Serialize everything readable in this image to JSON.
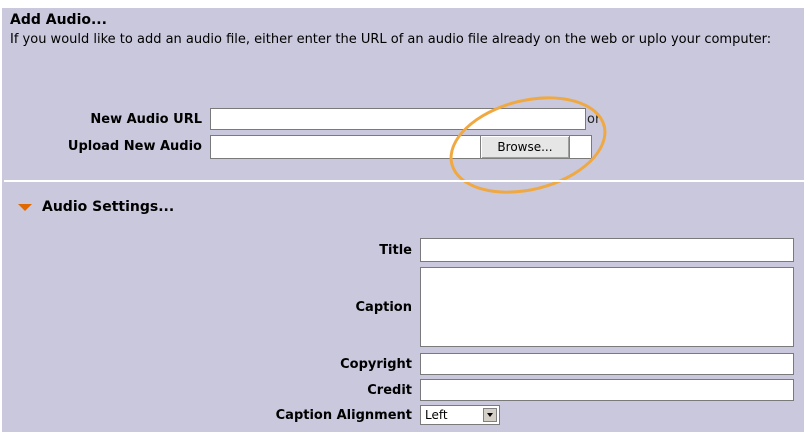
{
  "header": {
    "title": "Add Audio...",
    "description": "If you would like to add an audio file, either enter the URL of an audio file already on the web or uplo your computer:"
  },
  "audio_source": {
    "url_label": "New Audio URL",
    "url_value": "",
    "or_text": "or",
    "upload_label": "Upload New Audio",
    "upload_value": "",
    "browse_label": "Browse..."
  },
  "settings": {
    "section_title": "Audio Settings...",
    "title_label": "Title",
    "title_value": "",
    "caption_label": "Caption",
    "caption_value": "",
    "copyright_label": "Copyright",
    "copyright_value": "",
    "credit_label": "Credit",
    "credit_value": "",
    "alignment_label": "Caption Alignment",
    "alignment_value": "Left"
  },
  "colors": {
    "panel": "#c9c8dc",
    "highlight_circle": "#f0a840",
    "section_arrow": "#e06a00"
  }
}
